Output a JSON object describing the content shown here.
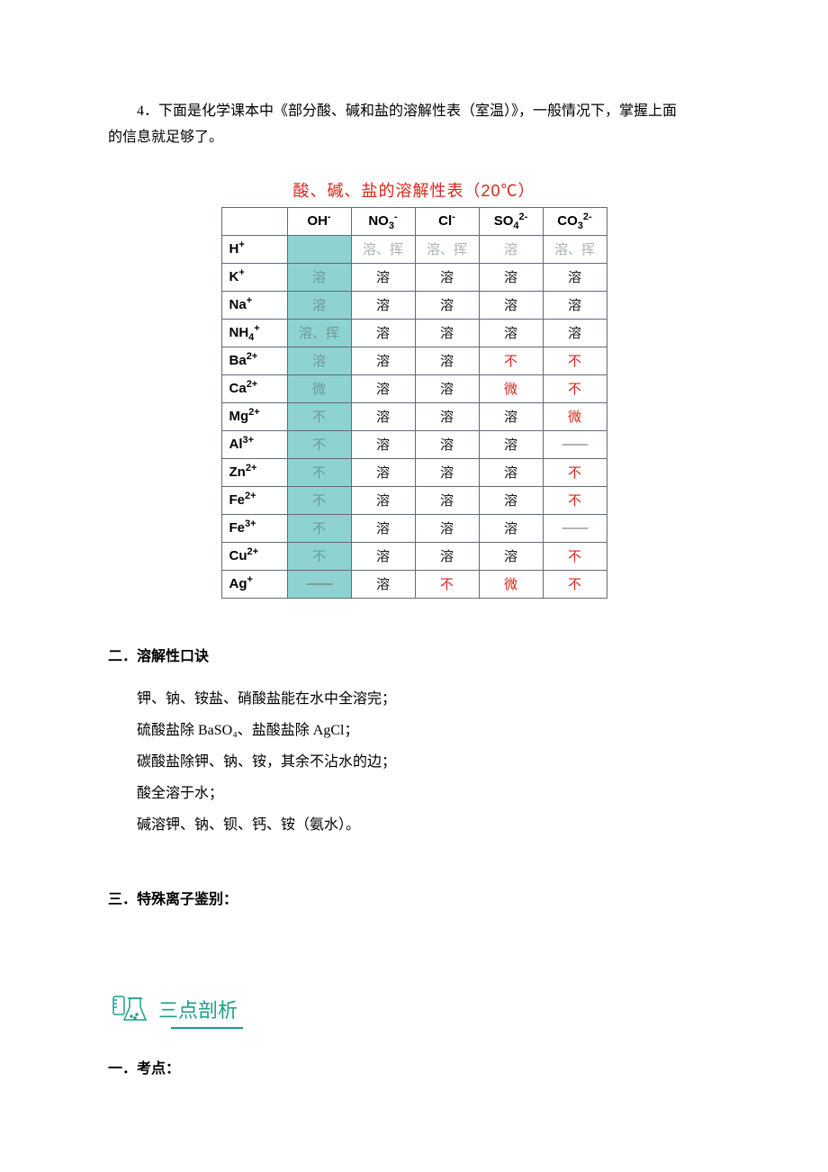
{
  "intro": {
    "num": "4．",
    "line1": "下面是化学课本中《部分酸、碱和盐的溶解性表（室温）》，一般情况下，掌握上面",
    "line2": "的信息就足够了。"
  },
  "table": {
    "title": "酸、碱、盐的溶解性表（20℃）",
    "headers": [
      "",
      "OH⁻",
      "NO₃⁻",
      "Cl⁻",
      "SO₄²⁻",
      "CO₃²⁻"
    ],
    "rows": [
      {
        "ion": "H⁺",
        "cells": [
          {
            "t": "",
            "cls": "cell-oh"
          },
          {
            "t": "溶、挥",
            "cls": "cell-faint"
          },
          {
            "t": "溶、挥",
            "cls": "cell-faint"
          },
          {
            "t": "溶",
            "cls": "cell-faint"
          },
          {
            "t": "溶、挥",
            "cls": "cell-faint"
          }
        ]
      },
      {
        "ion": "K⁺",
        "cells": [
          {
            "t": "溶",
            "cls": "cell-oh oh-text"
          },
          {
            "t": "溶",
            "cls": "cell-normal"
          },
          {
            "t": "溶",
            "cls": "cell-normal"
          },
          {
            "t": "溶",
            "cls": "cell-normal"
          },
          {
            "t": "溶",
            "cls": "cell-normal"
          }
        ]
      },
      {
        "ion": "Na⁺",
        "cells": [
          {
            "t": "溶",
            "cls": "cell-oh oh-text"
          },
          {
            "t": "溶",
            "cls": "cell-normal"
          },
          {
            "t": "溶",
            "cls": "cell-normal"
          },
          {
            "t": "溶",
            "cls": "cell-normal"
          },
          {
            "t": "溶",
            "cls": "cell-normal"
          }
        ]
      },
      {
        "ion": "NH₄⁺",
        "cells": [
          {
            "t": "溶、挥",
            "cls": "cell-oh oh-text"
          },
          {
            "t": "溶",
            "cls": "cell-normal"
          },
          {
            "t": "溶",
            "cls": "cell-normal"
          },
          {
            "t": "溶",
            "cls": "cell-normal"
          },
          {
            "t": "溶",
            "cls": "cell-normal"
          }
        ]
      },
      {
        "ion": "Ba²⁺",
        "cells": [
          {
            "t": "溶",
            "cls": "cell-oh oh-text"
          },
          {
            "t": "溶",
            "cls": "cell-normal"
          },
          {
            "t": "溶",
            "cls": "cell-normal"
          },
          {
            "t": "不",
            "cls": "cell-red"
          },
          {
            "t": "不",
            "cls": "cell-red"
          }
        ]
      },
      {
        "ion": "Ca²⁺",
        "cells": [
          {
            "t": "微",
            "cls": "cell-oh oh-text"
          },
          {
            "t": "溶",
            "cls": "cell-normal"
          },
          {
            "t": "溶",
            "cls": "cell-normal"
          },
          {
            "t": "微",
            "cls": "cell-red"
          },
          {
            "t": "不",
            "cls": "cell-red"
          }
        ]
      },
      {
        "ion": "Mg²⁺",
        "cells": [
          {
            "t": "不",
            "cls": "cell-oh oh-text"
          },
          {
            "t": "溶",
            "cls": "cell-normal"
          },
          {
            "t": "溶",
            "cls": "cell-normal"
          },
          {
            "t": "溶",
            "cls": "cell-normal"
          },
          {
            "t": "微",
            "cls": "cell-red"
          }
        ]
      },
      {
        "ion": "Al³⁺",
        "cells": [
          {
            "t": "不",
            "cls": "cell-oh oh-text"
          },
          {
            "t": "溶",
            "cls": "cell-normal"
          },
          {
            "t": "溶",
            "cls": "cell-normal"
          },
          {
            "t": "溶",
            "cls": "cell-normal"
          },
          {
            "t": "——",
            "cls": "dash"
          }
        ]
      },
      {
        "ion": "Zn²⁺",
        "cells": [
          {
            "t": "不",
            "cls": "cell-oh oh-text"
          },
          {
            "t": "溶",
            "cls": "cell-normal"
          },
          {
            "t": "溶",
            "cls": "cell-normal"
          },
          {
            "t": "溶",
            "cls": "cell-normal"
          },
          {
            "t": "不",
            "cls": "cell-red"
          }
        ]
      },
      {
        "ion": "Fe²⁺",
        "cells": [
          {
            "t": "不",
            "cls": "cell-oh oh-text"
          },
          {
            "t": "溶",
            "cls": "cell-normal"
          },
          {
            "t": "溶",
            "cls": "cell-normal"
          },
          {
            "t": "溶",
            "cls": "cell-normal"
          },
          {
            "t": "不",
            "cls": "cell-red"
          }
        ]
      },
      {
        "ion": "Fe³⁺",
        "cells": [
          {
            "t": "不",
            "cls": "cell-oh oh-text"
          },
          {
            "t": "溶",
            "cls": "cell-normal"
          },
          {
            "t": "溶",
            "cls": "cell-normal"
          },
          {
            "t": "溶",
            "cls": "cell-normal"
          },
          {
            "t": "——",
            "cls": "dash"
          }
        ]
      },
      {
        "ion": "Cu²⁺",
        "cells": [
          {
            "t": "不",
            "cls": "cell-oh oh-text"
          },
          {
            "t": "溶",
            "cls": "cell-normal"
          },
          {
            "t": "溶",
            "cls": "cell-normal"
          },
          {
            "t": "溶",
            "cls": "cell-normal"
          },
          {
            "t": "不",
            "cls": "cell-red"
          }
        ]
      },
      {
        "ion": "Ag⁺",
        "cells": [
          {
            "t": "——",
            "cls": "cell-oh dash"
          },
          {
            "t": "溶",
            "cls": "cell-normal"
          },
          {
            "t": "不",
            "cls": "cell-red"
          },
          {
            "t": "微",
            "cls": "cell-red"
          },
          {
            "t": "不",
            "cls": "cell-red"
          }
        ]
      }
    ]
  },
  "section2": {
    "head": "二．溶解性口诀",
    "lines": [
      "钾、钠、铵盐、硝酸盐能在水中全溶完；",
      "硫酸盐除 BaSO₄、盐酸盐除 AgCl；",
      "碳酸盐除钾、钠、铵，其余不沾水的边；",
      "酸全溶于水；",
      "碱溶钾、钠、钡、钙、铵（氨水）。"
    ]
  },
  "section3": {
    "head": "三．特殊离子鉴别："
  },
  "analysis": "三点剖析",
  "kaodian": "一．考点："
}
